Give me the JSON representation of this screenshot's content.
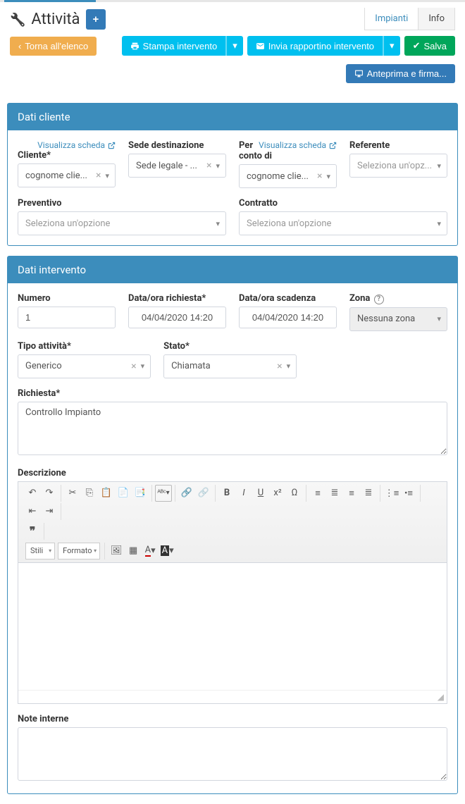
{
  "header": {
    "title": "Attività",
    "add_label": "+",
    "tabs": {
      "impianti": "Impianti",
      "info": "Info"
    }
  },
  "actions": {
    "back": "Torna all'elenco",
    "print": "Stampa intervento",
    "send": "Invia rapportino intervento",
    "save": "Salva",
    "preview": "Anteprima e firma..."
  },
  "panels": {
    "cliente": {
      "title": "Dati cliente",
      "visualizza": "Visualizza scheda",
      "fields": {
        "cliente_label": "Cliente*",
        "cliente_value": "cognome clie...",
        "sede_label": "Sede destinazione",
        "sede_value": "Sede legale - ...",
        "perconto_label": "Per conto di",
        "perconto_value": "cognome clie...",
        "referente_label": "Referente",
        "referente_placeholder": "Seleziona un'opz...",
        "preventivo_label": "Preventivo",
        "preventivo_placeholder": "Seleziona un'opzione",
        "contratto_label": "Contratto",
        "contratto_placeholder": "Seleziona un'opzione"
      }
    },
    "intervento": {
      "title": "Dati intervento",
      "fields": {
        "numero_label": "Numero",
        "numero_value": "1",
        "richiesta_dt_label": "Data/ora richiesta*",
        "richiesta_dt_value": "04/04/2020 14:20",
        "scadenza_dt_label": "Data/ora scadenza",
        "scadenza_dt_value": "04/04/2020 14:20",
        "zona_label": "Zona",
        "zona_value": "Nessuna zona",
        "tipo_label": "Tipo attività*",
        "tipo_value": "Generico",
        "stato_label": "Stato*",
        "stato_value": "Chiamata",
        "richiesta_label": "Richiesta*",
        "richiesta_value": "Controllo Impianto",
        "descrizione_label": "Descrizione",
        "note_label": "Note interne"
      }
    }
  },
  "editor": {
    "stili": "Stili",
    "formato": "Formato"
  }
}
